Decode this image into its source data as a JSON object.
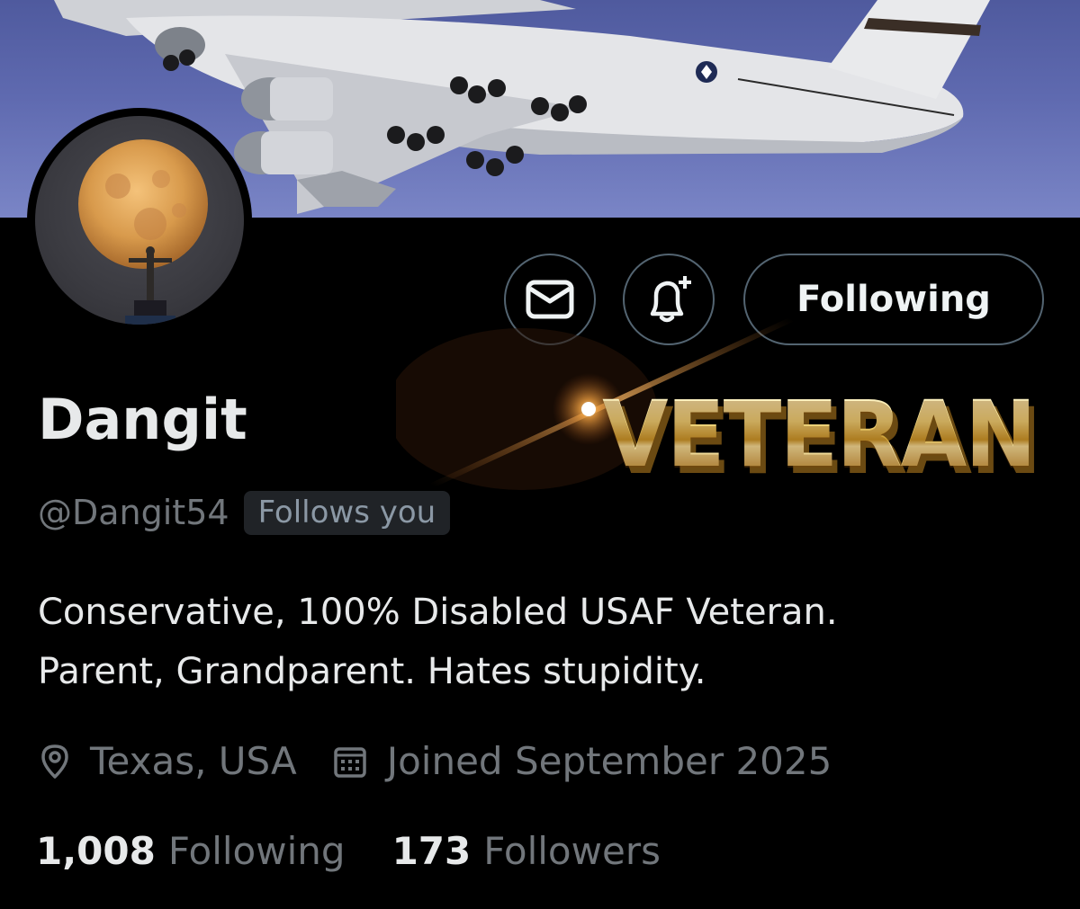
{
  "profile": {
    "display_name": "Dangit",
    "handle": "@Dangit54",
    "follows_you_badge": "Follows you",
    "bio_lines": [
      "Conservative, 100% Disabled USAF Veteran.",
      "Parent, Grandparent. Hates stupidity."
    ],
    "location": "Texas, USA",
    "joined": "Joined September 2025",
    "banner_image": "military-cargo-jet-in-flight",
    "avatar_image": "full-moon-behind-statue",
    "name_graphic_text": "VETERAN"
  },
  "actions": {
    "message_icon": "envelope-icon",
    "notify_icon": "bell-plus-icon",
    "following_label": "Following"
  },
  "stats": {
    "following_count": "1,008",
    "following_label": "Following",
    "followers_count": "173",
    "followers_label": "Followers"
  },
  "colors": {
    "background": "#000000",
    "text_primary": "#e7e9ea",
    "text_secondary": "#71767b",
    "border": "#536471",
    "badge_bg": "#202327"
  }
}
